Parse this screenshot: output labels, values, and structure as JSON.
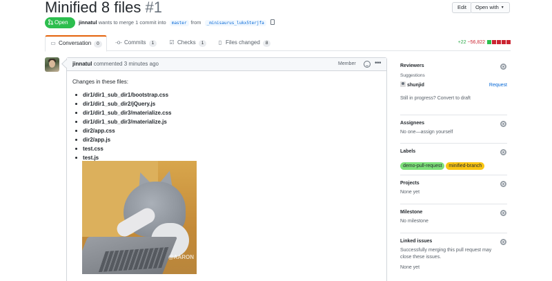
{
  "header": {
    "title": "Minified 8 files",
    "number": "#1",
    "edit_label": "Edit",
    "open_with_label": "Open with"
  },
  "meta": {
    "state": "Open",
    "author": "jinnatul",
    "action_text": "wants to merge 1 commit into",
    "base_branch": "master",
    "from_text": "from",
    "head_branch": "_minisaurus_lukx5terjfa"
  },
  "tabs": [
    {
      "label": "Conversation",
      "count": "0",
      "icon": "comment-icon"
    },
    {
      "label": "Commits",
      "count": "1",
      "icon": "commit-icon"
    },
    {
      "label": "Checks",
      "count": "1",
      "icon": "checks-icon"
    },
    {
      "label": "Files changed",
      "count": "8",
      "icon": "file-diff-icon"
    }
  ],
  "diffstat": {
    "additions": "+22",
    "deletions": "−56,822"
  },
  "comment": {
    "author": "jinnatul",
    "timestamp_text": "commented 3 minutes ago",
    "role": "Member",
    "intro": "Changes in these files:",
    "files": [
      "dir1/dir1_sub_dir1/bootstrap.css",
      "dir1/dir1_sub_dir2/jQuery.js",
      "dir1/dir1_sub_dir3/materialize.css",
      "dir1/dir1_sub_dir3/materialize.js",
      "dir2/app.css",
      "dir2/app.js",
      "test.css",
      "test.js"
    ],
    "gif_watermark": "@AARON"
  },
  "sidebar": {
    "reviewers": {
      "title": "Reviewers",
      "subtitle": "Suggestions",
      "suggested_user": "shunjid",
      "request_label": "Request",
      "draft_text": "Still in progress? Convert to draft"
    },
    "assignees": {
      "title": "Assignees",
      "text": "No one—assign yourself"
    },
    "labels": {
      "title": "Labels",
      "items": [
        {
          "name": "demo-pull-request",
          "color": "#7ee07a"
        },
        {
          "name": "minified-branch",
          "color": "#f9c513"
        }
      ]
    },
    "projects": {
      "title": "Projects",
      "text": "None yet"
    },
    "milestone": {
      "title": "Milestone",
      "text": "No milestone"
    },
    "linked_issues": {
      "title": "Linked issues",
      "text": "Successfully merging this pull request may close these issues.",
      "empty": "None yet"
    }
  },
  "colors": {
    "open_green": "#2cbe4e",
    "link_blue": "#0366d6",
    "tab_accent": "#e36209",
    "additions": "#28a745",
    "deletions": "#cb2431"
  }
}
